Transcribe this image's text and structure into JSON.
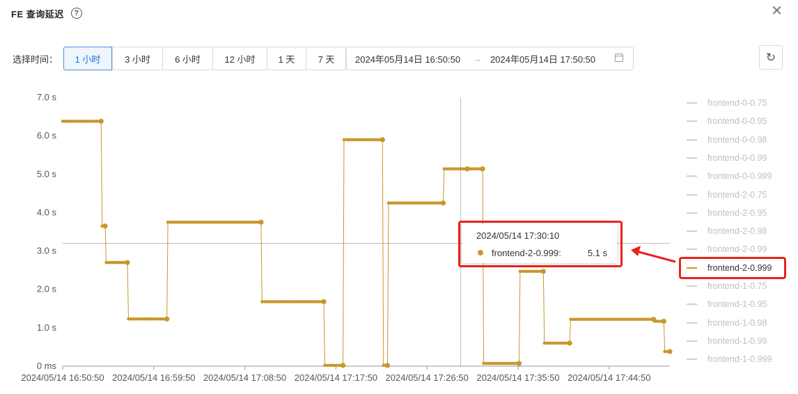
{
  "header": {
    "title": "FE 查询延迟",
    "help_icon": "?",
    "close_icon": "✕"
  },
  "toolbar": {
    "time_label": "选择时间：",
    "ranges": [
      {
        "label": "1 小时",
        "active": true
      },
      {
        "label": "3 小时"
      },
      {
        "label": "6 小时"
      },
      {
        "label": "12 小时"
      },
      {
        "label": "1 天"
      },
      {
        "label": "7 天"
      }
    ],
    "date_start": "2024年05月14日 16:50:50",
    "date_arrow": "→",
    "date_end": "2024年05月14日 17:50:50",
    "refresh_icon": "↻"
  },
  "legend": [
    "frontend-0-0.75",
    "frontend-0-0.95",
    "frontend-0-0.98",
    "frontend-0-0.99",
    "frontend-0-0.999",
    "frontend-2-0.75",
    "frontend-2-0.95",
    "frontend-2-0.98",
    "frontend-2-0.99",
    "frontend-2-0.999",
    "frontend-1-0.75",
    "frontend-1-0.95",
    "frontend-1-0.98",
    "frontend-1-0.99",
    "frontend-1-0.999"
  ],
  "tooltip": {
    "time": "2024/05/14 17:30:10",
    "series": "frontend-2-0.999:",
    "value": "5.1 s"
  },
  "chart_data": {
    "type": "line",
    "x_ticks": [
      "2024/05/14 16:50:50",
      "2024/05/14 16:59:50",
      "2024/05/14 17:08:50",
      "2024/05/14 17:17:50",
      "2024/05/14 17:26:50",
      "2024/05/14 17:35:50",
      "2024/05/14 17:44:50"
    ],
    "y_ticks": [
      "0 ms",
      "1.0 s",
      "2.0 s",
      "3.0 s",
      "4.0 s",
      "5.0 s",
      "6.0 s",
      "7.0 s"
    ],
    "ylim": [
      0,
      7
    ],
    "x_unit": "minutes after 16:50:50",
    "active_series": "frontend-2-0.999",
    "color": "#c9972b",
    "series": [
      {
        "name": "frontend-2-0.999",
        "segments": [
          {
            "x": [
              0.0,
              3.8
            ],
            "y": 6.38
          },
          {
            "x": [
              3.9,
              4.2
            ],
            "y": 3.65
          },
          {
            "x": [
              4.3,
              6.4
            ],
            "y": 2.7
          },
          {
            "x": [
              6.5,
              10.3
            ],
            "y": 1.23
          },
          {
            "x": [
              10.4,
              19.6
            ],
            "y": 3.75
          },
          {
            "x": [
              19.7,
              25.8
            ],
            "y": 1.68
          },
          {
            "x": [
              25.9,
              27.7
            ],
            "y": 0.02
          },
          {
            "x": [
              27.8,
              31.6
            ],
            "y": 5.9
          },
          {
            "x": [
              31.7,
              32.1
            ],
            "y": 0.02
          },
          {
            "x": [
              32.2,
              37.6
            ],
            "y": 4.25
          },
          {
            "x": [
              37.7,
              40.0
            ],
            "y": 5.14
          },
          {
            "x": [
              40.1,
              41.5
            ],
            "y": 5.14
          },
          {
            "x": [
              41.6,
              45.1
            ],
            "y": 0.07
          },
          {
            "x": [
              45.2,
              47.5
            ],
            "y": 2.47
          },
          {
            "x": [
              47.6,
              50.1
            ],
            "y": 0.6
          },
          {
            "x": [
              50.2,
              58.4
            ],
            "y": 1.22
          },
          {
            "x": [
              58.5,
              59.4
            ],
            "y": 1.17
          },
          {
            "x": [
              59.5,
              60.0
            ],
            "y": 0.38
          }
        ]
      }
    ],
    "crosshair": {
      "x": 39.33,
      "y": 3.2
    }
  }
}
